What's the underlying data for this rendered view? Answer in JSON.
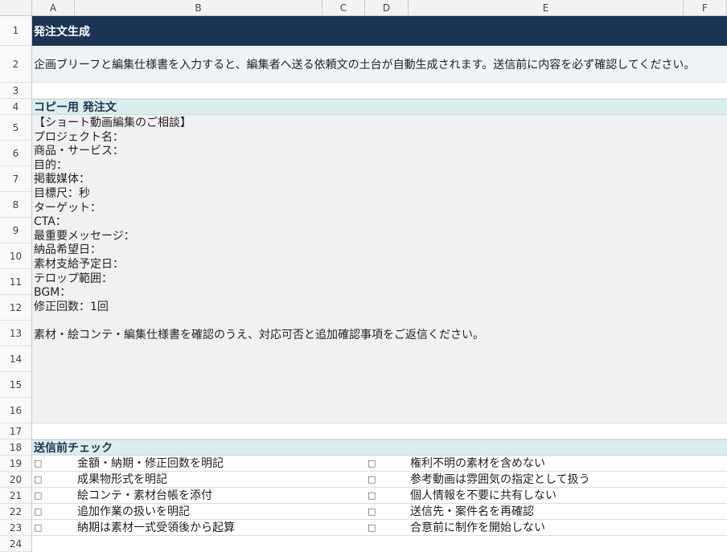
{
  "columns": [
    "A",
    "B",
    "C",
    "D",
    "E",
    "F"
  ],
  "rows": [
    "1",
    "2",
    "3",
    "4",
    "5",
    "6",
    "7",
    "8",
    "9",
    "10",
    "11",
    "12",
    "13",
    "14",
    "15",
    "16",
    "17",
    "18",
    "19",
    "20",
    "21",
    "22",
    "23",
    "24"
  ],
  "title": "発注文生成",
  "description": "企画ブリーフと編集仕様書を入力すると、編集者へ送る依頼文の土台が自動生成されます。送信前に内容を必ず確認してください。",
  "copy_section_title": "コピー用 発注文",
  "order_text": "【ショート動画編集のご相談】\nプロジェクト名：\n商品・サービス：\n目的：\n掲載媒体：\n目標尺：秒\nターゲット：\nCTA：\n最重要メッセージ：\n納品希望日：\n素材支給予定日：\nテロップ範囲：\nBGM：\n修正回数：1回\n\n素材・絵コンテ・編集仕様書を確認のうえ、対応可否と追加確認事項をご返信ください。",
  "checklist_title": "送信前チェック",
  "checkbox_glyph": "□",
  "checklist": [
    {
      "left": "金額・納期・修正回数を明記",
      "right": "権利不明の素材を含めない"
    },
    {
      "left": "成果物形式を明記",
      "right": "参考動画は雰囲気の指定として扱う"
    },
    {
      "left": "絵コンテ・素材台帳を添付",
      "right": "個人情報を不要に共有しない"
    },
    {
      "left": "追加作業の扱いを明記",
      "right": "送信先・案件名を再確認"
    },
    {
      "left": "納期は素材一式受領後から起算",
      "right": "合意前に制作を開始しない"
    }
  ],
  "colors": {
    "title_bg": "#1b3453",
    "desc_bg": "#eef3f8",
    "section_bg": "#dbeeee",
    "body_bg": "#f0f1f3"
  }
}
